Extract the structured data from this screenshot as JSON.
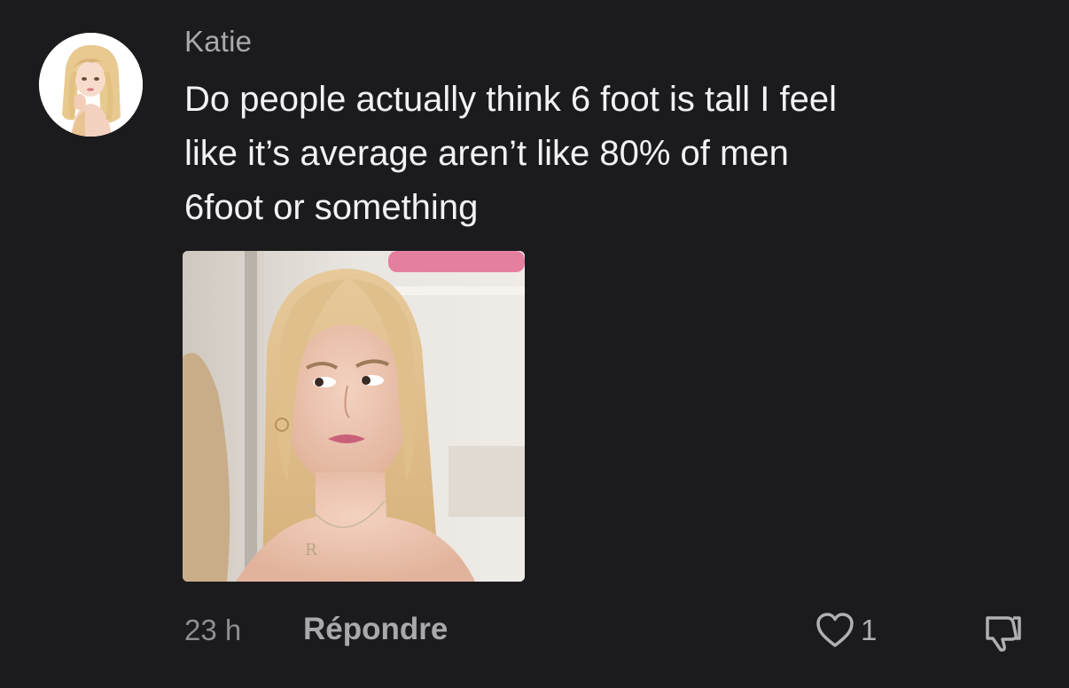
{
  "comment": {
    "author": "Katie",
    "text": "Do people actually think 6 foot is tall I feel\nlike it’s average aren’t like 80% of men\n6foot or something",
    "timestamp": "23 h",
    "reply_label": "Répondre",
    "like_count": "1",
    "icons": {
      "avatar": "avatar-illustration",
      "like": "heart-outline-icon",
      "dislike": "thumbs-down-icon"
    },
    "colors": {
      "background": "#1b1b1d",
      "text": "#f2f2f4",
      "muted": "#a9a9ad"
    }
  }
}
